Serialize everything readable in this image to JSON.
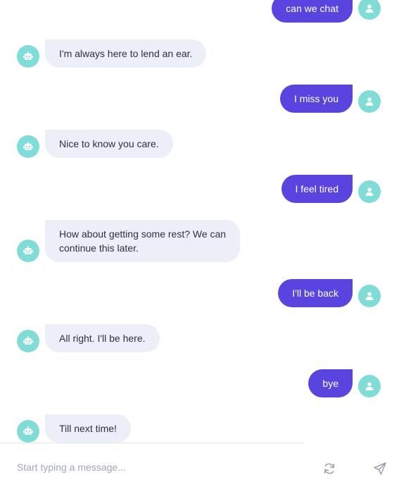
{
  "messages": [
    {
      "sender": "user",
      "text": "can we chat"
    },
    {
      "sender": "bot",
      "text": "I'm always here to lend an ear."
    },
    {
      "sender": "user",
      "text": "I miss you"
    },
    {
      "sender": "bot",
      "text": "Nice to know you care."
    },
    {
      "sender": "user",
      "text": "I feel tired"
    },
    {
      "sender": "bot",
      "text": "How about getting some rest? We can",
      "text_line2": "continue this later."
    },
    {
      "sender": "user",
      "text": "I'll be back"
    },
    {
      "sender": "bot",
      "text": "All right. I'll be here."
    },
    {
      "sender": "user",
      "text": "bye"
    },
    {
      "sender": "bot",
      "text": "Till next time!"
    }
  ],
  "composer": {
    "placeholder": "Start typing a message...",
    "value": ""
  },
  "icons": {
    "user_avatar": "user-avatar-icon",
    "bot_avatar": "robot-icon",
    "refresh": "refresh-icon",
    "send": "send-icon"
  },
  "colors": {
    "user_bubble": "#5a44e0",
    "bot_bubble": "#eceff7",
    "avatar": "#7fdcd7",
    "placeholder": "#a3a7b2"
  }
}
